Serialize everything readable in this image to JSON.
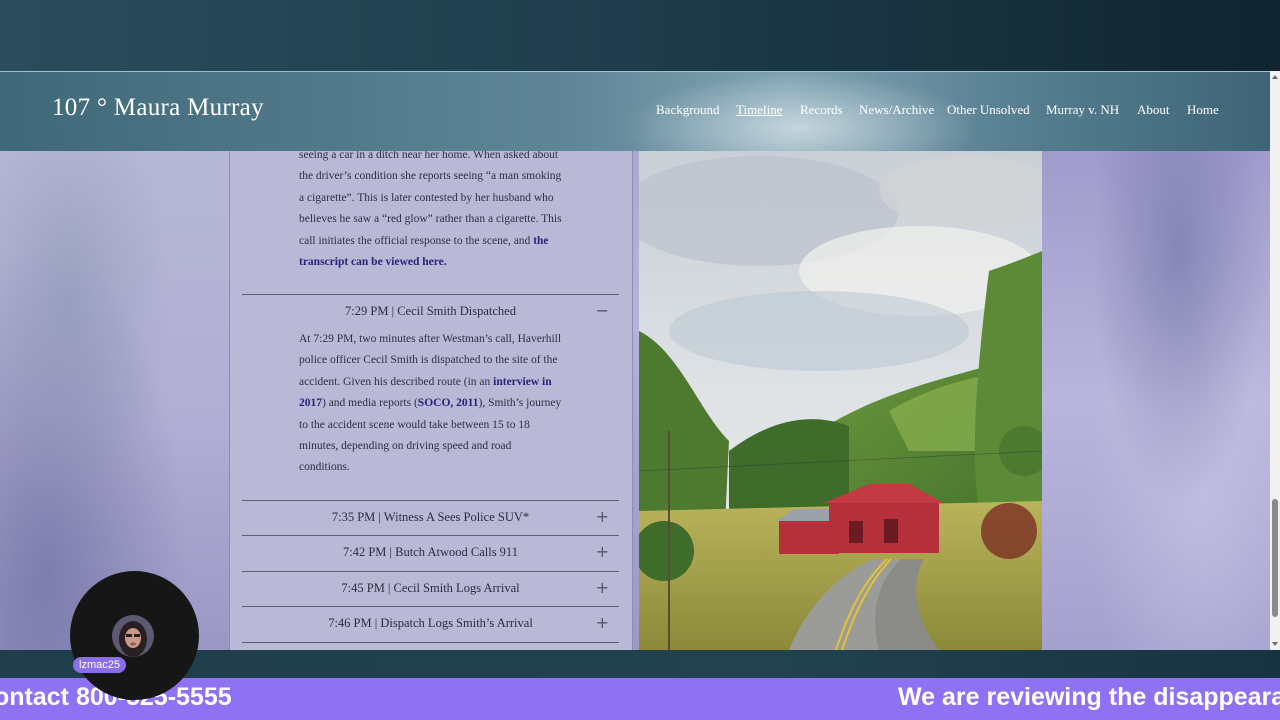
{
  "header": {
    "site_title": "107 ° Maura Murray",
    "nav": [
      "Background",
      "Timeline",
      "Records",
      "News/Archive",
      "Other Unsolved",
      "Murray v. NH",
      "About",
      "Home"
    ],
    "active_nav": "Timeline"
  },
  "content": {
    "intro_paragraph": {
      "line1": "seeing a car in a ditch near her home. When asked about",
      "line2": "the driver’s condition she reports seeing “a man smoking",
      "line3": "a cigarette”. This is later contested by her husband who",
      "line4": "believes he saw a “red glow” rather than a cigarette.  This",
      "line5_text": "call initiates the official response to the scene, and ",
      "line5_link": "the",
      "line6_link": "transcript can be viewed here."
    },
    "expanded_item": {
      "title": "7:29 PM | Cecil Smith Dispatched",
      "icon": "−",
      "line1": "At 7:29 PM, two minutes after Westman’s call, Haverhill",
      "line2": "police officer Cecil Smith is dispatched to the site of the",
      "line3_text": "accident. Given his described route (in an ",
      "line3_link": "interview in",
      "line4_link": "2017",
      "line4_text": ") and media reports (",
      "line4_link2": "SOCO, 2011",
      "line4_text2": "), Smith’s journey",
      "line5": "to the accident scene would take between 15 to 18",
      "line6": "minutes, depending on driving speed and road",
      "line7": "conditions."
    },
    "collapsed_items": [
      {
        "title": "7:35 PM | Witness A Sees Police SUV*",
        "icon": "+"
      },
      {
        "title": "7:42 PM | Butch Atwood Calls 911",
        "icon": "+"
      },
      {
        "title": "7:45 PM | Cecil Smith Logs Arrival",
        "icon": "+"
      },
      {
        "title": "7:46 PM | Dispatch Logs Smith’s Arrival",
        "icon": "+"
      }
    ]
  },
  "ticker": {
    "left_text": "ontact 800-525-5555",
    "right_text": "We are reviewing the disappeara"
  },
  "avatar": {
    "username": "lzmac25"
  },
  "colors": {
    "ticker_bg": "#8f71f4",
    "link": "#26257a",
    "barn_red": "#b5303a"
  }
}
